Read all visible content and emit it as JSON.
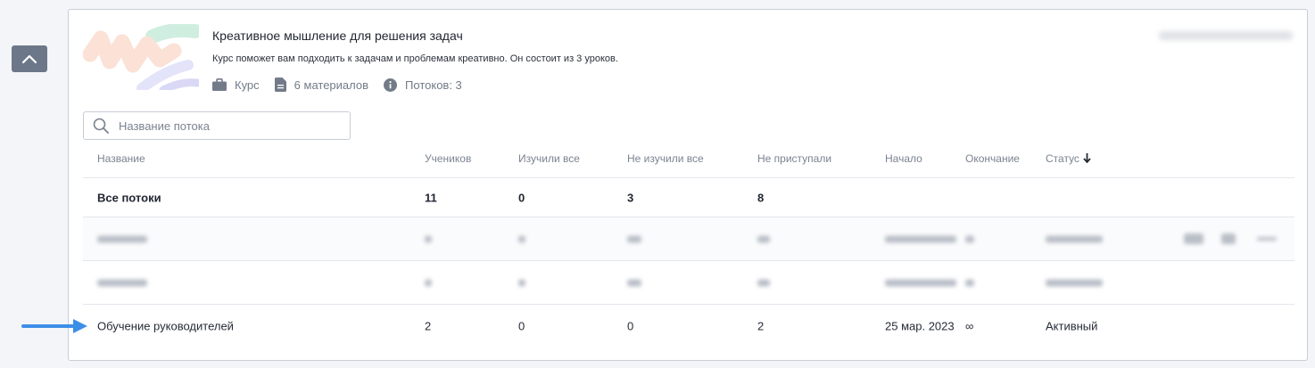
{
  "course": {
    "title": "Креативное мышление для решения задач",
    "description": "Курс поможет вам подходить к задачам и проблемам креативно. Он состоит из 3 уроков.",
    "type_label": "Курс",
    "materials_label": "6 материалов",
    "streams_label": "Потоков: 3"
  },
  "search": {
    "placeholder": "Название потока"
  },
  "table": {
    "columns": [
      "Название",
      "Учеников",
      "Изучили все",
      "Не изучили все",
      "Не приступали",
      "Начало",
      "Окончание",
      "Статус"
    ],
    "all_row": {
      "name": "Все потоки",
      "students": "11",
      "completed": "0",
      "not_completed": "3",
      "not_started": "8"
    },
    "highlighted_row": {
      "name": "Обучение руководителей",
      "students": "2",
      "completed": "0",
      "not_completed": "0",
      "not_started": "2",
      "start": "25 мар. 2023",
      "end": "∞",
      "status": "Активный"
    }
  },
  "colors": {
    "collapse_button": "#6c7889",
    "arrow": "#3d8fe6",
    "card_border": "#c9cdd6"
  },
  "icons": {
    "collapse": "chevron-up-icon",
    "type": "briefcase-icon",
    "materials": "document-icon",
    "streams": "info-icon",
    "search": "search-icon",
    "sort": "arrow-down-icon"
  }
}
